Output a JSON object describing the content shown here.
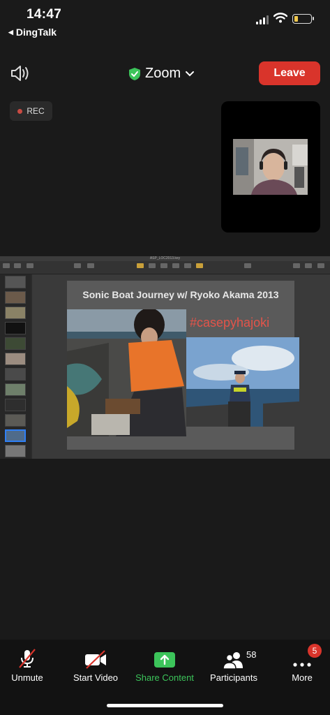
{
  "status": {
    "time": "14:47",
    "back_app": "DingTalk"
  },
  "top": {
    "title": "Zoom",
    "leave_label": "Leave"
  },
  "rec": {
    "label": "REC"
  },
  "shared_screen": {
    "window_title": "ASP_LOC2013.key",
    "slide": {
      "title": "Sonic Boat Journey w/ Ryoko Akama 2013",
      "hashtag": "#casepyhajoki"
    }
  },
  "toolbar": {
    "unmute": "Unmute",
    "start_video": "Start Video",
    "share_content": "Share Content",
    "participants": "Participants",
    "participants_count": "58",
    "more": "More",
    "more_badge": "5"
  },
  "colors": {
    "leave": "#d9342b",
    "share_green": "#3cc45a",
    "shield_green": "#3cc45a",
    "hashtag": "#e3544a"
  },
  "icons": [
    "speaker-icon",
    "shield-check-icon",
    "chevron-down-icon",
    "mic-off-icon",
    "video-off-icon",
    "share-arrow-icon",
    "participants-icon",
    "more-dots-icon"
  ]
}
